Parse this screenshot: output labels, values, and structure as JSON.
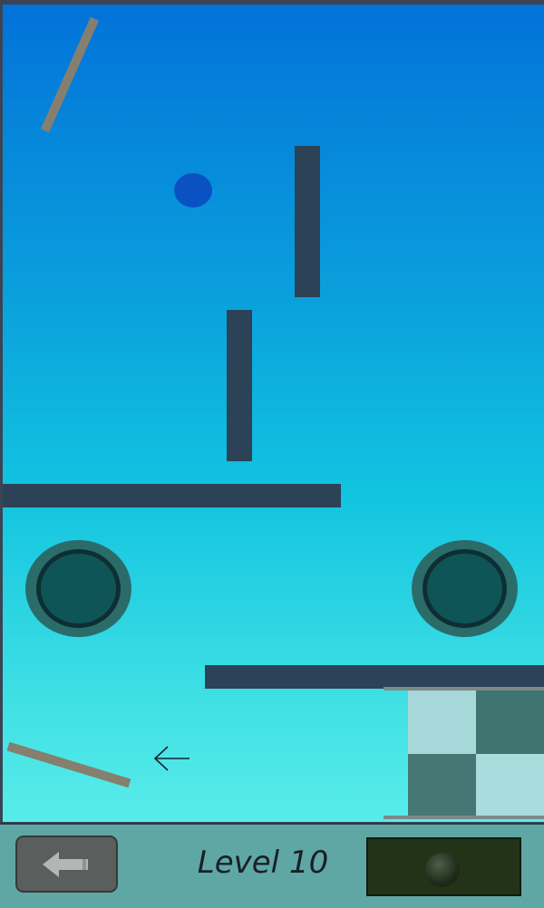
{
  "game": {
    "level_label": "Level 10",
    "colors": {
      "sky_top": "#0272d9",
      "sky_bottom": "#58ecea",
      "wall": "#2c4256",
      "plank": "#857f70",
      "ball": "#0a52c4",
      "hole_ring": "#2b6c6b",
      "goal_light": "#a6d8d9",
      "goal_dark": "#477774",
      "bottom_bar": "#5fa7a5"
    },
    "icons": {
      "back": "back-arrow-icon",
      "hint_arrow": "left-arrow-icon",
      "ball_selector": "ball-icon"
    }
  }
}
